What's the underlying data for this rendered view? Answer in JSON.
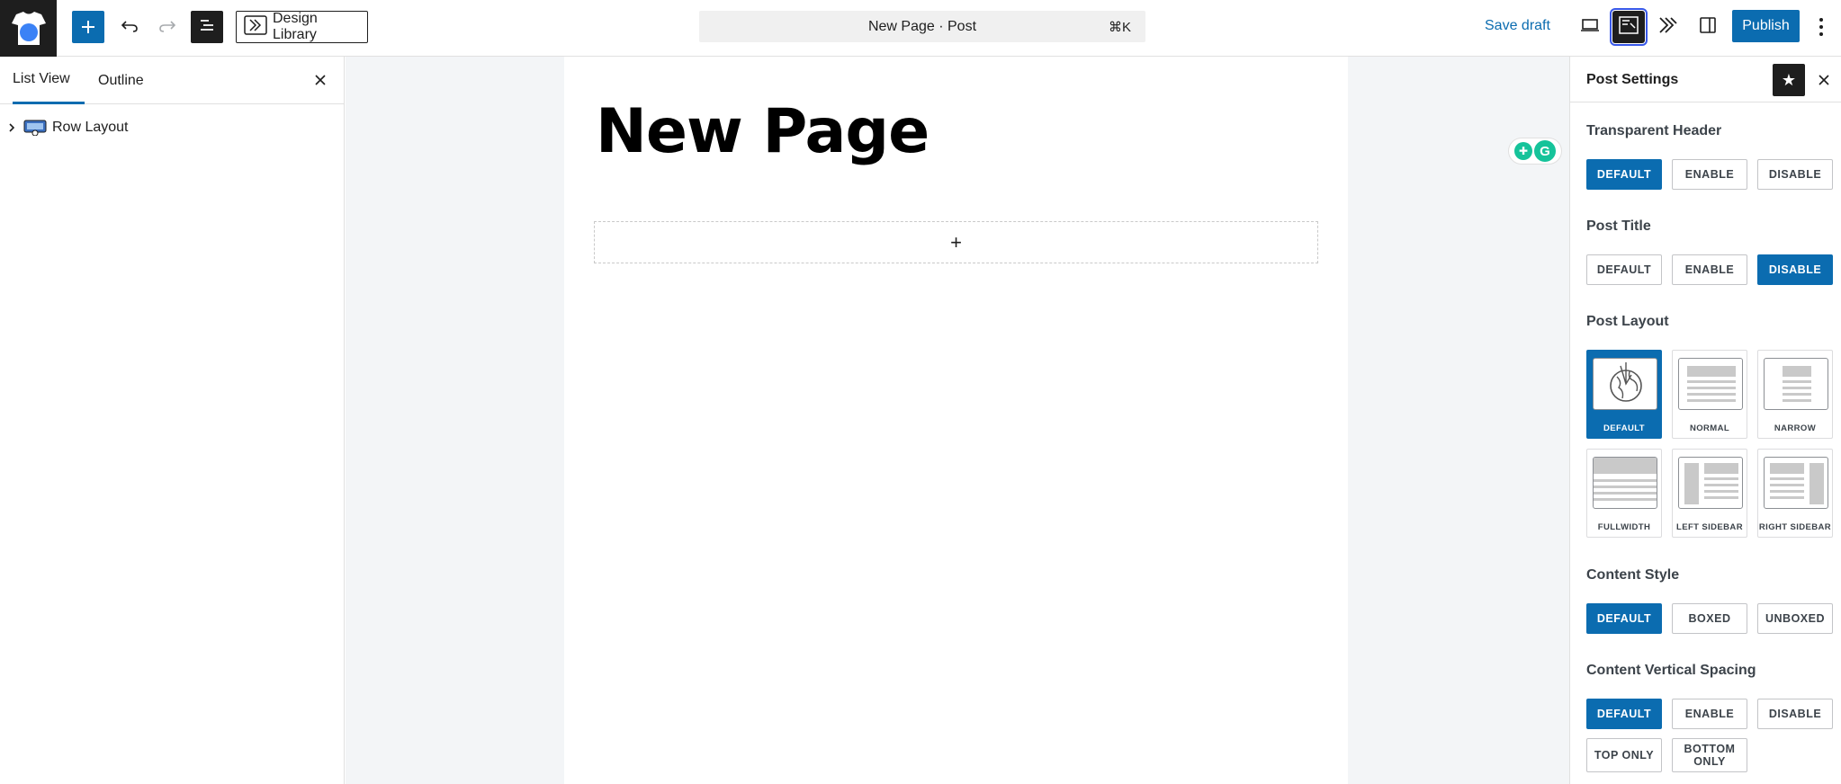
{
  "toolbar": {
    "design_library_label": "Design Library",
    "document_title": "New Page · Post",
    "shortcut": "⌘K",
    "save_draft_label": "Save draft",
    "publish_label": "Publish"
  },
  "left_panel": {
    "tabs": [
      {
        "label": "List View",
        "active": true
      },
      {
        "label": "Outline",
        "active": false
      }
    ],
    "tree": [
      {
        "label": "Row Layout"
      }
    ]
  },
  "canvas": {
    "page_title": "New Page",
    "appender_symbol": "+"
  },
  "sidebar": {
    "title": "Post Settings",
    "transparent_header": {
      "label": "Transparent Header",
      "options": [
        "DEFAULT",
        "ENABLE",
        "DISABLE"
      ],
      "selected": "DEFAULT"
    },
    "post_title": {
      "label": "Post Title",
      "options": [
        "DEFAULT",
        "ENABLE",
        "DISABLE"
      ],
      "selected": "DISABLE"
    },
    "post_layout": {
      "label": "Post Layout",
      "options": [
        "DEFAULT",
        "NORMAL",
        "NARROW",
        "FULLWIDTH",
        "LEFT SIDEBAR",
        "RIGHT SIDEBAR"
      ],
      "selected": "DEFAULT"
    },
    "content_style": {
      "label": "Content Style",
      "options": [
        "DEFAULT",
        "BOXED",
        "UNBOXED"
      ],
      "selected": "DEFAULT"
    },
    "content_vertical_spacing": {
      "label": "Content Vertical Spacing",
      "options": [
        "DEFAULT",
        "ENABLE",
        "DISABLE",
        "TOP ONLY",
        "BOTTOM ONLY"
      ],
      "selected": "DEFAULT"
    }
  },
  "colors": {
    "accent": "#0b6cb0",
    "dark": "#1e1e1e"
  }
}
